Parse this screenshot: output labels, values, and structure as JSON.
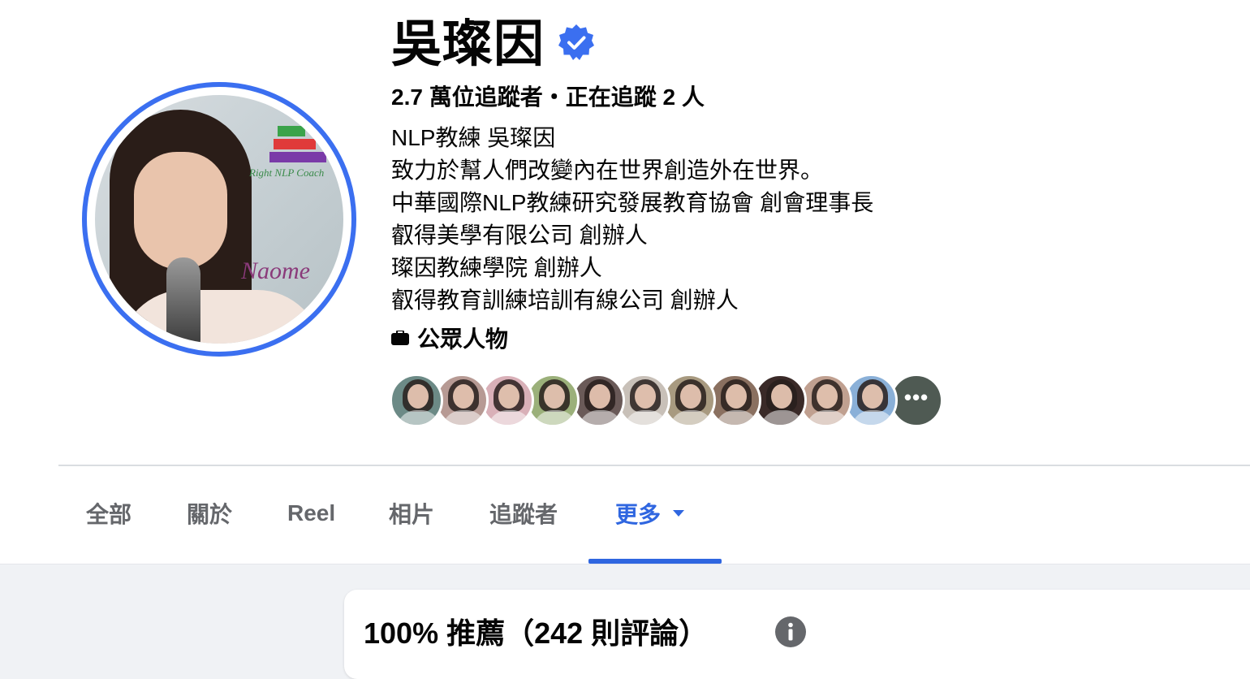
{
  "profile": {
    "name": "吳璨因",
    "verified": true,
    "follow_stats": "2.7 萬位追蹤者・正在追蹤 2 人",
    "avatar_caption": "Right NLP Coach",
    "avatar_signature": "Naome",
    "bio": [
      "NLP教練 吳璨因",
      "致力於幫人們改變內在世界創造外在世界。",
      "中華國際NLP教練研究發展教育協會 創會理事長",
      "叡得美學有限公司 創辦人",
      "璨因教練學院 創辦人",
      "叡得教育訓練培訓有線公司 創辦人"
    ],
    "category_icon": "briefcase-icon",
    "category": "公眾人物",
    "follower_avatars": [
      "#6c8a86",
      "#b79a94",
      "#d9b0b8",
      "#9bb07a",
      "#6a5a58",
      "#c8c0b8",
      "#a89a80",
      "#8a7060",
      "#3a2a28",
      "#c0a090",
      "#8ab0d8"
    ],
    "more_followers_label": "•••",
    "more_followers_color": "#7a8a80"
  },
  "tabs": [
    {
      "label": "全部",
      "active": false
    },
    {
      "label": "關於",
      "active": false
    },
    {
      "label": "Reel",
      "active": false
    },
    {
      "label": "相片",
      "active": false
    },
    {
      "label": "追蹤者",
      "active": false
    },
    {
      "label": "更多",
      "active": true,
      "has_dropdown": true
    }
  ],
  "reviews": {
    "title": "100% 推薦（242 則評論）",
    "info_icon": "info-icon"
  },
  "colors": {
    "accent": "#2f66e0",
    "verified": "#3b6ff0",
    "tab_inactive": "#65676b",
    "page_bg": "#f0f2f5"
  }
}
